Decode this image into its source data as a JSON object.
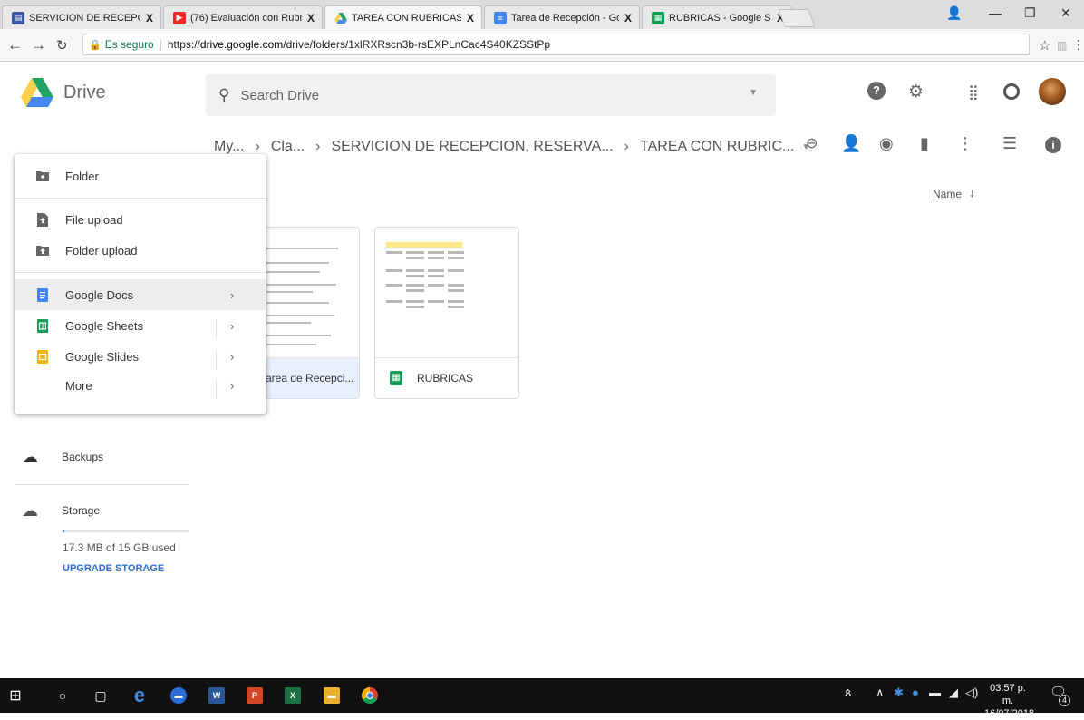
{
  "browser": {
    "tabs": [
      {
        "title": "SERVICION DE RECEPCIO",
        "favicon": "classroom-icon",
        "color": "#3b5ba9",
        "active": false
      },
      {
        "title": "(76) Evaluación con Rubr",
        "favicon": "youtube-icon",
        "color": "#e52d27",
        "active": false
      },
      {
        "title": "TAREA CON RUBRICAS - ",
        "favicon": "drive-icon",
        "color": "#1fa463",
        "active": true
      },
      {
        "title": "Tarea de Recepción - Goo",
        "favicon": "docs-icon",
        "color": "#4285f4",
        "active": false
      },
      {
        "title": "RUBRICAS - Google Shee",
        "favicon": "sheets-icon",
        "color": "#0f9d58",
        "active": false
      }
    ],
    "close_symbol": "X",
    "secure_label": "Es seguro",
    "url_scheme": "https://",
    "url_host": "drive.google.com",
    "url_path": "/drive/folders/1xlRXRscn3b-rsEXPLnCac4S40KZSStPp"
  },
  "header": {
    "brand": "Drive",
    "search_placeholder": "Search Drive"
  },
  "breadcrumb": {
    "items": [
      "My...",
      "Cla...",
      "SERVICION DE RECEPCION, RESERVA...",
      "TAREA CON RUBRIC..."
    ]
  },
  "sort": {
    "label": "Name"
  },
  "files": [
    {
      "name": "Tarea de Recepci...",
      "type": "docs",
      "selected": true
    },
    {
      "name": "RUBRICAS",
      "type": "sheets",
      "selected": false
    }
  ],
  "new_menu": {
    "items": [
      {
        "label": "Folder",
        "icon": "folder-plus-icon",
        "arrow": false,
        "highlighted": false
      },
      {
        "label": "File upload",
        "icon": "file-upload-icon",
        "arrow": false,
        "highlighted": false
      },
      {
        "label": "Folder upload",
        "icon": "folder-upload-icon",
        "arrow": false,
        "highlighted": false
      },
      {
        "label": "Google Docs",
        "icon": "docs-icon",
        "arrow": true,
        "highlighted": true
      },
      {
        "label": "Google Sheets",
        "icon": "sheets-icon",
        "arrow": true,
        "highlighted": false
      },
      {
        "label": "Google Slides",
        "icon": "slides-icon",
        "arrow": true,
        "highlighted": false
      },
      {
        "label": "More",
        "icon": "",
        "arrow": true,
        "highlighted": false
      }
    ]
  },
  "sidebar": {
    "backups_label": "Backups",
    "storage_label": "Storage",
    "storage_used": "17.3 MB of 15 GB used",
    "storage_fraction": 0.0011,
    "upgrade_label": "UPGRADE STORAGE"
  },
  "taskbar": {
    "time": "03:57 p. m.",
    "date": "16/07/2018",
    "notifications": "4"
  },
  "colors": {
    "accent_blue": "#4285f4",
    "sheets_green": "#0f9d58",
    "slides_yellow": "#f4b400",
    "drive_yellow": "#ffcf48"
  }
}
